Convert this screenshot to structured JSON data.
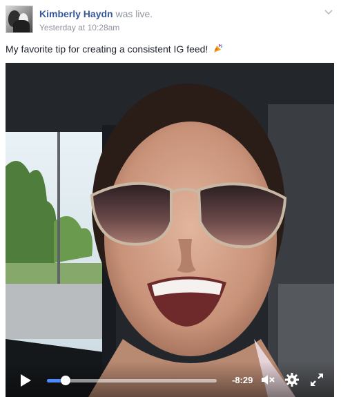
{
  "post": {
    "author_name": "Kimberly Haydn",
    "activity": "was live.",
    "timestamp": "Yesterday at 10:28am",
    "caption": "My favorite tip for creating a consistent IG feed!",
    "caption_emoji_icon": "party-popper-icon",
    "menu_icon": "chevron-down-icon"
  },
  "video": {
    "time_remaining": "-8:29",
    "progress_fraction": 0.11,
    "controls": {
      "play_icon": "play-icon",
      "mute_icon": "volume-muted-icon",
      "settings_icon": "gear-icon",
      "fullscreen_icon": "fullscreen-icon"
    }
  },
  "colors": {
    "author_link": "#365899",
    "meta_text": "#90949c",
    "body_text": "#1d2129",
    "progress_fill": "#4a8cff"
  }
}
